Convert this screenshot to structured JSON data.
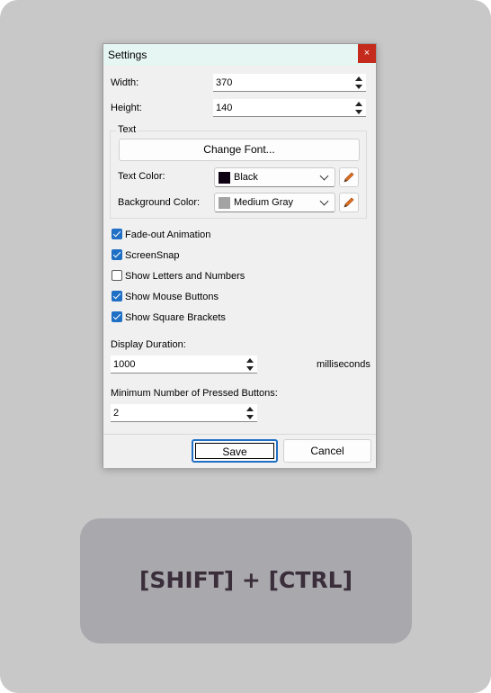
{
  "dialog": {
    "title": "Settings",
    "close_label": "×",
    "width": {
      "label": "Width:",
      "value": "370"
    },
    "height": {
      "label": "Height:",
      "value": "140"
    },
    "text_group": {
      "title": "Text",
      "change_font_label": "Change Font...",
      "text_color": {
        "label": "Text Color:",
        "value": "Black",
        "swatch": "#0c0012"
      },
      "background_color": {
        "label": "Background Color:",
        "value": "Medium Gray",
        "swatch": "#a3a3a3"
      }
    },
    "checkboxes": [
      {
        "label": "Fade-out Animation",
        "checked": true
      },
      {
        "label": "ScreenSnap",
        "checked": true
      },
      {
        "label": "Show Letters and Numbers",
        "checked": false
      },
      {
        "label": "Show Mouse Buttons",
        "checked": true
      },
      {
        "label": "Show Square Brackets",
        "checked": true
      }
    ],
    "display_duration": {
      "label": "Display Duration:",
      "value": "1000",
      "unit": "milliseconds"
    },
    "min_pressed": {
      "label": "Minimum Number of Pressed Buttons:",
      "value": "2"
    },
    "buttons": {
      "save": "Save",
      "cancel": "Cancel"
    }
  },
  "overlay": {
    "text": "[SHIFT] + [CTRL]"
  },
  "colors": {
    "accent": "#1f6fc5",
    "close": "#c42b1c",
    "backdrop": "#c8c8c8",
    "overlay": "#a9a8ad"
  }
}
